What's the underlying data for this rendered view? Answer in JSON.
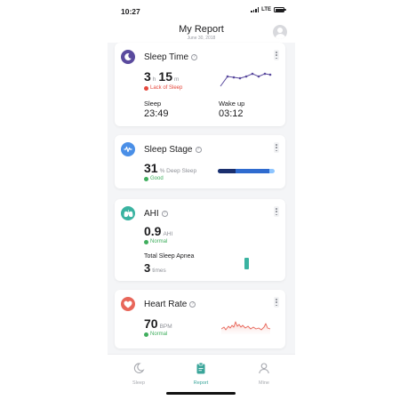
{
  "status_bar": {
    "time": "10:27",
    "network": "LTE"
  },
  "header": {
    "title": "My Report",
    "date": "June 30, 2018"
  },
  "cards": {
    "sleep_time": {
      "title": "Sleep Time",
      "hours": "3",
      "hours_unit": "h",
      "minutes": "15",
      "minutes_unit": "m",
      "status": "Lack of Sleep",
      "sleep_label": "Sleep",
      "sleep_value": "23:49",
      "wake_label": "Wake up",
      "wake_value": "03:12"
    },
    "sleep_stage": {
      "title": "Sleep Stage",
      "value": "31",
      "unit": "% Deep Sleep",
      "status": "Good",
      "deep_fraction": 0.31
    },
    "ahi": {
      "title": "AHI",
      "value": "0.9",
      "unit": "AHI",
      "status": "Normal",
      "apnea_label": "Total Sleep Apnea",
      "apnea_value": "3",
      "apnea_unit": "times"
    },
    "heart_rate": {
      "title": "Heart Rate",
      "value": "70",
      "unit": "BPM",
      "status": "Normal"
    }
  },
  "tabs": [
    {
      "label": "Sleep",
      "active": false
    },
    {
      "label": "Report",
      "active": true
    },
    {
      "label": "Mine",
      "active": false
    }
  ],
  "colors": {
    "sleep_purple": "#5a4a9e",
    "stage_blue": "#4a8fe7",
    "ahi_teal": "#3ab3a1",
    "heart_red": "#e8665a",
    "warning_red": "#e5483d",
    "good_green": "#3fae5d"
  }
}
